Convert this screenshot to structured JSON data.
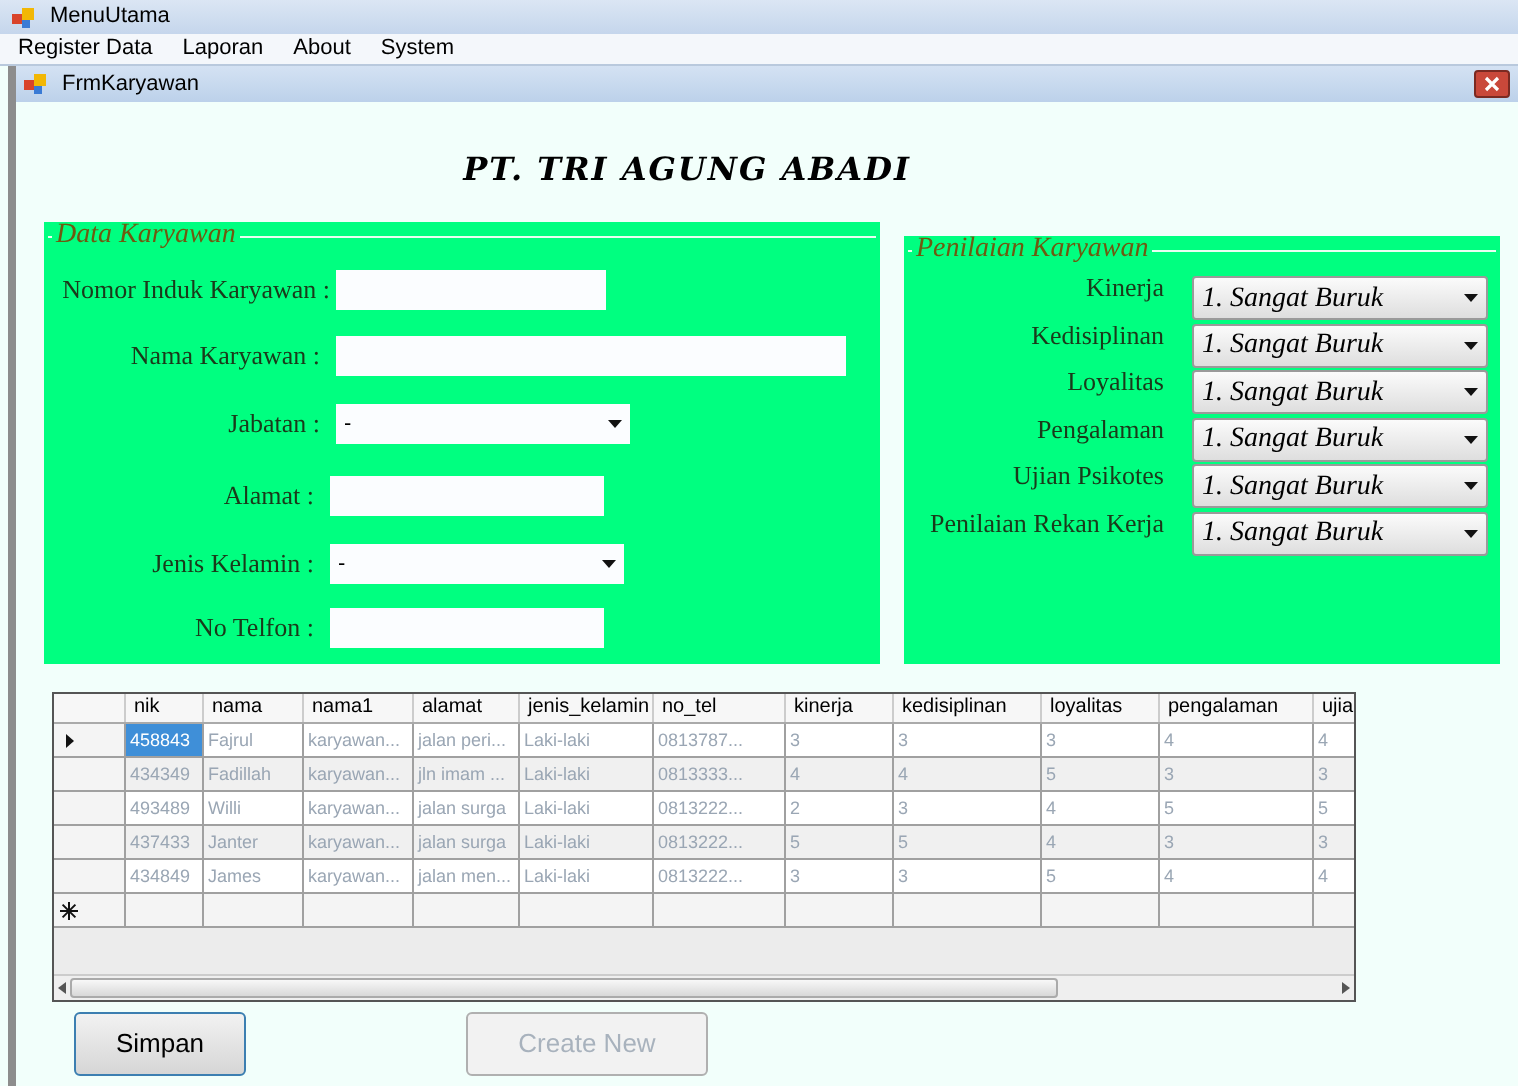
{
  "window": {
    "title": "MenuUtama"
  },
  "menu": [
    "Register Data",
    "Laporan",
    "About",
    "System"
  ],
  "child_window": {
    "title": "FrmKaryawan"
  },
  "heading": "PT. TRI AGUNG ABADI",
  "data_karyawan": {
    "title": "Data Karyawan",
    "fields": [
      {
        "label": "Nomor Induk Karyawan :",
        "kind": "text"
      },
      {
        "label": "Nama Karyawan :",
        "kind": "text"
      },
      {
        "label": "Jabatan :",
        "kind": "select",
        "value": "-"
      },
      {
        "label": "Alamat :",
        "kind": "text"
      },
      {
        "label": "Jenis Kelamin :",
        "kind": "select",
        "value": "-"
      },
      {
        "label": "No Telfon :",
        "kind": "text"
      }
    ]
  },
  "penilaian": {
    "title": "Penilaian Karyawan",
    "fields": [
      {
        "label": "Kinerja",
        "value": "1. Sangat Buruk"
      },
      {
        "label": "Kedisiplinan",
        "value": "1. Sangat Buruk"
      },
      {
        "label": "Loyalitas",
        "value": "1. Sangat Buruk"
      },
      {
        "label": "Pengalaman",
        "value": "1. Sangat Buruk"
      },
      {
        "label": "Ujian Psikotes",
        "value": "1. Sangat Buruk"
      },
      {
        "label": "Penilaian Rekan Kerja",
        "value": "1. Sangat Buruk"
      }
    ]
  },
  "table": {
    "columns": [
      "nik",
      "nama",
      "nama1",
      "alamat",
      "jenis_kelamin",
      "no_tel",
      "kinerja",
      "kedisiplinan",
      "loyalitas",
      "pengalaman",
      "ujia"
    ],
    "rows": [
      {
        "selected": true,
        "cells": [
          "458843",
          "Fajrul",
          "karyawan...",
          "jalan peri...",
          "Laki-laki",
          "0813787...",
          "3",
          "3",
          "3",
          "4",
          "4"
        ]
      },
      {
        "selected": false,
        "cells": [
          "434349",
          "Fadillah",
          "karyawan...",
          "jln imam ...",
          "Laki-laki",
          "0813333...",
          "4",
          "4",
          "5",
          "3",
          "3"
        ]
      },
      {
        "selected": false,
        "cells": [
          "493489",
          "Willi",
          "karyawan...",
          "jalan surga",
          "Laki-laki",
          "0813222...",
          "2",
          "3",
          "4",
          "5",
          "5"
        ]
      },
      {
        "selected": false,
        "cells": [
          "437433",
          "Janter",
          "karyawan...",
          "jalan surga",
          "Laki-laki",
          "0813222...",
          "5",
          "5",
          "4",
          "3",
          "3"
        ]
      },
      {
        "selected": false,
        "cells": [
          "434849",
          "James",
          "karyawan...",
          "jalan men...",
          "Laki-laki",
          "0813222...",
          "3",
          "3",
          "5",
          "4",
          "4"
        ]
      }
    ]
  },
  "buttons": [
    {
      "label": "Simpan",
      "disabled": false
    },
    {
      "label": "Create New",
      "disabled": true
    }
  ]
}
